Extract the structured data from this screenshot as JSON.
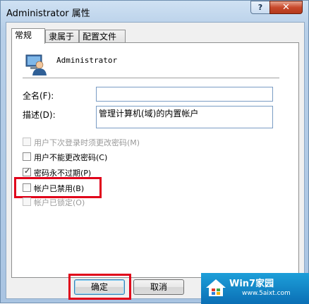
{
  "window": {
    "title": "Administrator 属性",
    "help_glyph": "?",
    "close_glyph": "✕"
  },
  "tabs": [
    {
      "label": "常规",
      "active": true
    },
    {
      "label": "隶属于"
    },
    {
      "label": "配置文件"
    }
  ],
  "user": {
    "name": "Administrator",
    "icon": "user-icon"
  },
  "fields": {
    "full_name": {
      "label": "全名(F):",
      "value": ""
    },
    "description": {
      "label": "描述(D):",
      "value": "管理计算机(域)的内置帐户"
    }
  },
  "checkboxes": [
    {
      "label": "用户下次登录时须更改密码(M)",
      "checked": false,
      "enabled": false
    },
    {
      "label": "用户不能更改密码(C)",
      "checked": false,
      "enabled": true
    },
    {
      "label": "密码永不过期(P)",
      "checked": true,
      "enabled": true
    },
    {
      "label": "帐户已禁用(B)",
      "checked": false,
      "enabled": true
    },
    {
      "label": "帐户已锁定(O)",
      "checked": false,
      "enabled": false
    }
  ],
  "buttons": {
    "ok": "确定",
    "cancel": "取消"
  },
  "watermark": {
    "title": "Win7家园",
    "url": "www.5aixt.com"
  },
  "colors": {
    "highlight": "#e0001a",
    "title_bar": "#b7cfe8"
  }
}
